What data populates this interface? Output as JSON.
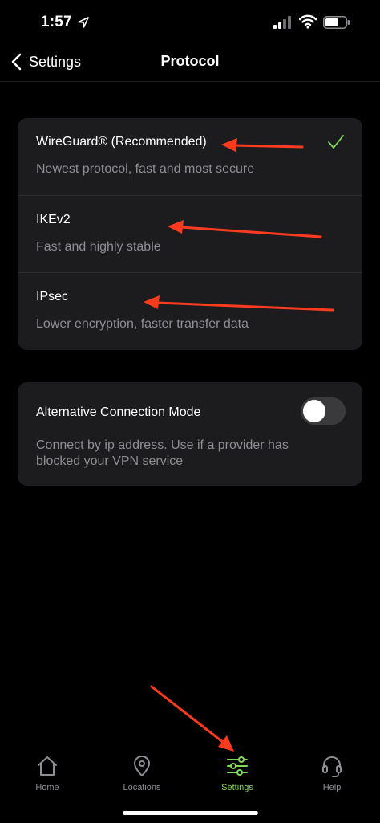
{
  "status_bar": {
    "time": "1:57"
  },
  "nav": {
    "back_label": "Settings",
    "title": "Protocol"
  },
  "protocols": [
    {
      "name": "WireGuard® (Recommended)",
      "description": "Newest protocol, fast and most secure",
      "selected": true
    },
    {
      "name": "IKEv2",
      "description": "Fast and highly stable",
      "selected": false
    },
    {
      "name": "IPsec",
      "description": "Lower encryption, faster transfer data",
      "selected": false
    }
  ],
  "alternative_mode": {
    "title": "Alternative Connection Mode",
    "description": "Connect by ip address. Use if a provider has blocked your VPN service",
    "enabled": false
  },
  "tabs": [
    {
      "label": "Home",
      "icon": "home-icon",
      "active": false
    },
    {
      "label": "Locations",
      "icon": "location-pin-icon",
      "active": false
    },
    {
      "label": "Settings",
      "icon": "sliders-icon",
      "active": true
    },
    {
      "label": "Help",
      "icon": "headset-icon",
      "active": false
    }
  ],
  "colors": {
    "accent": "#7ed957",
    "annotation": "#ff3b1f",
    "card": "#1c1c1e",
    "secondary_text": "#8e8e93"
  }
}
